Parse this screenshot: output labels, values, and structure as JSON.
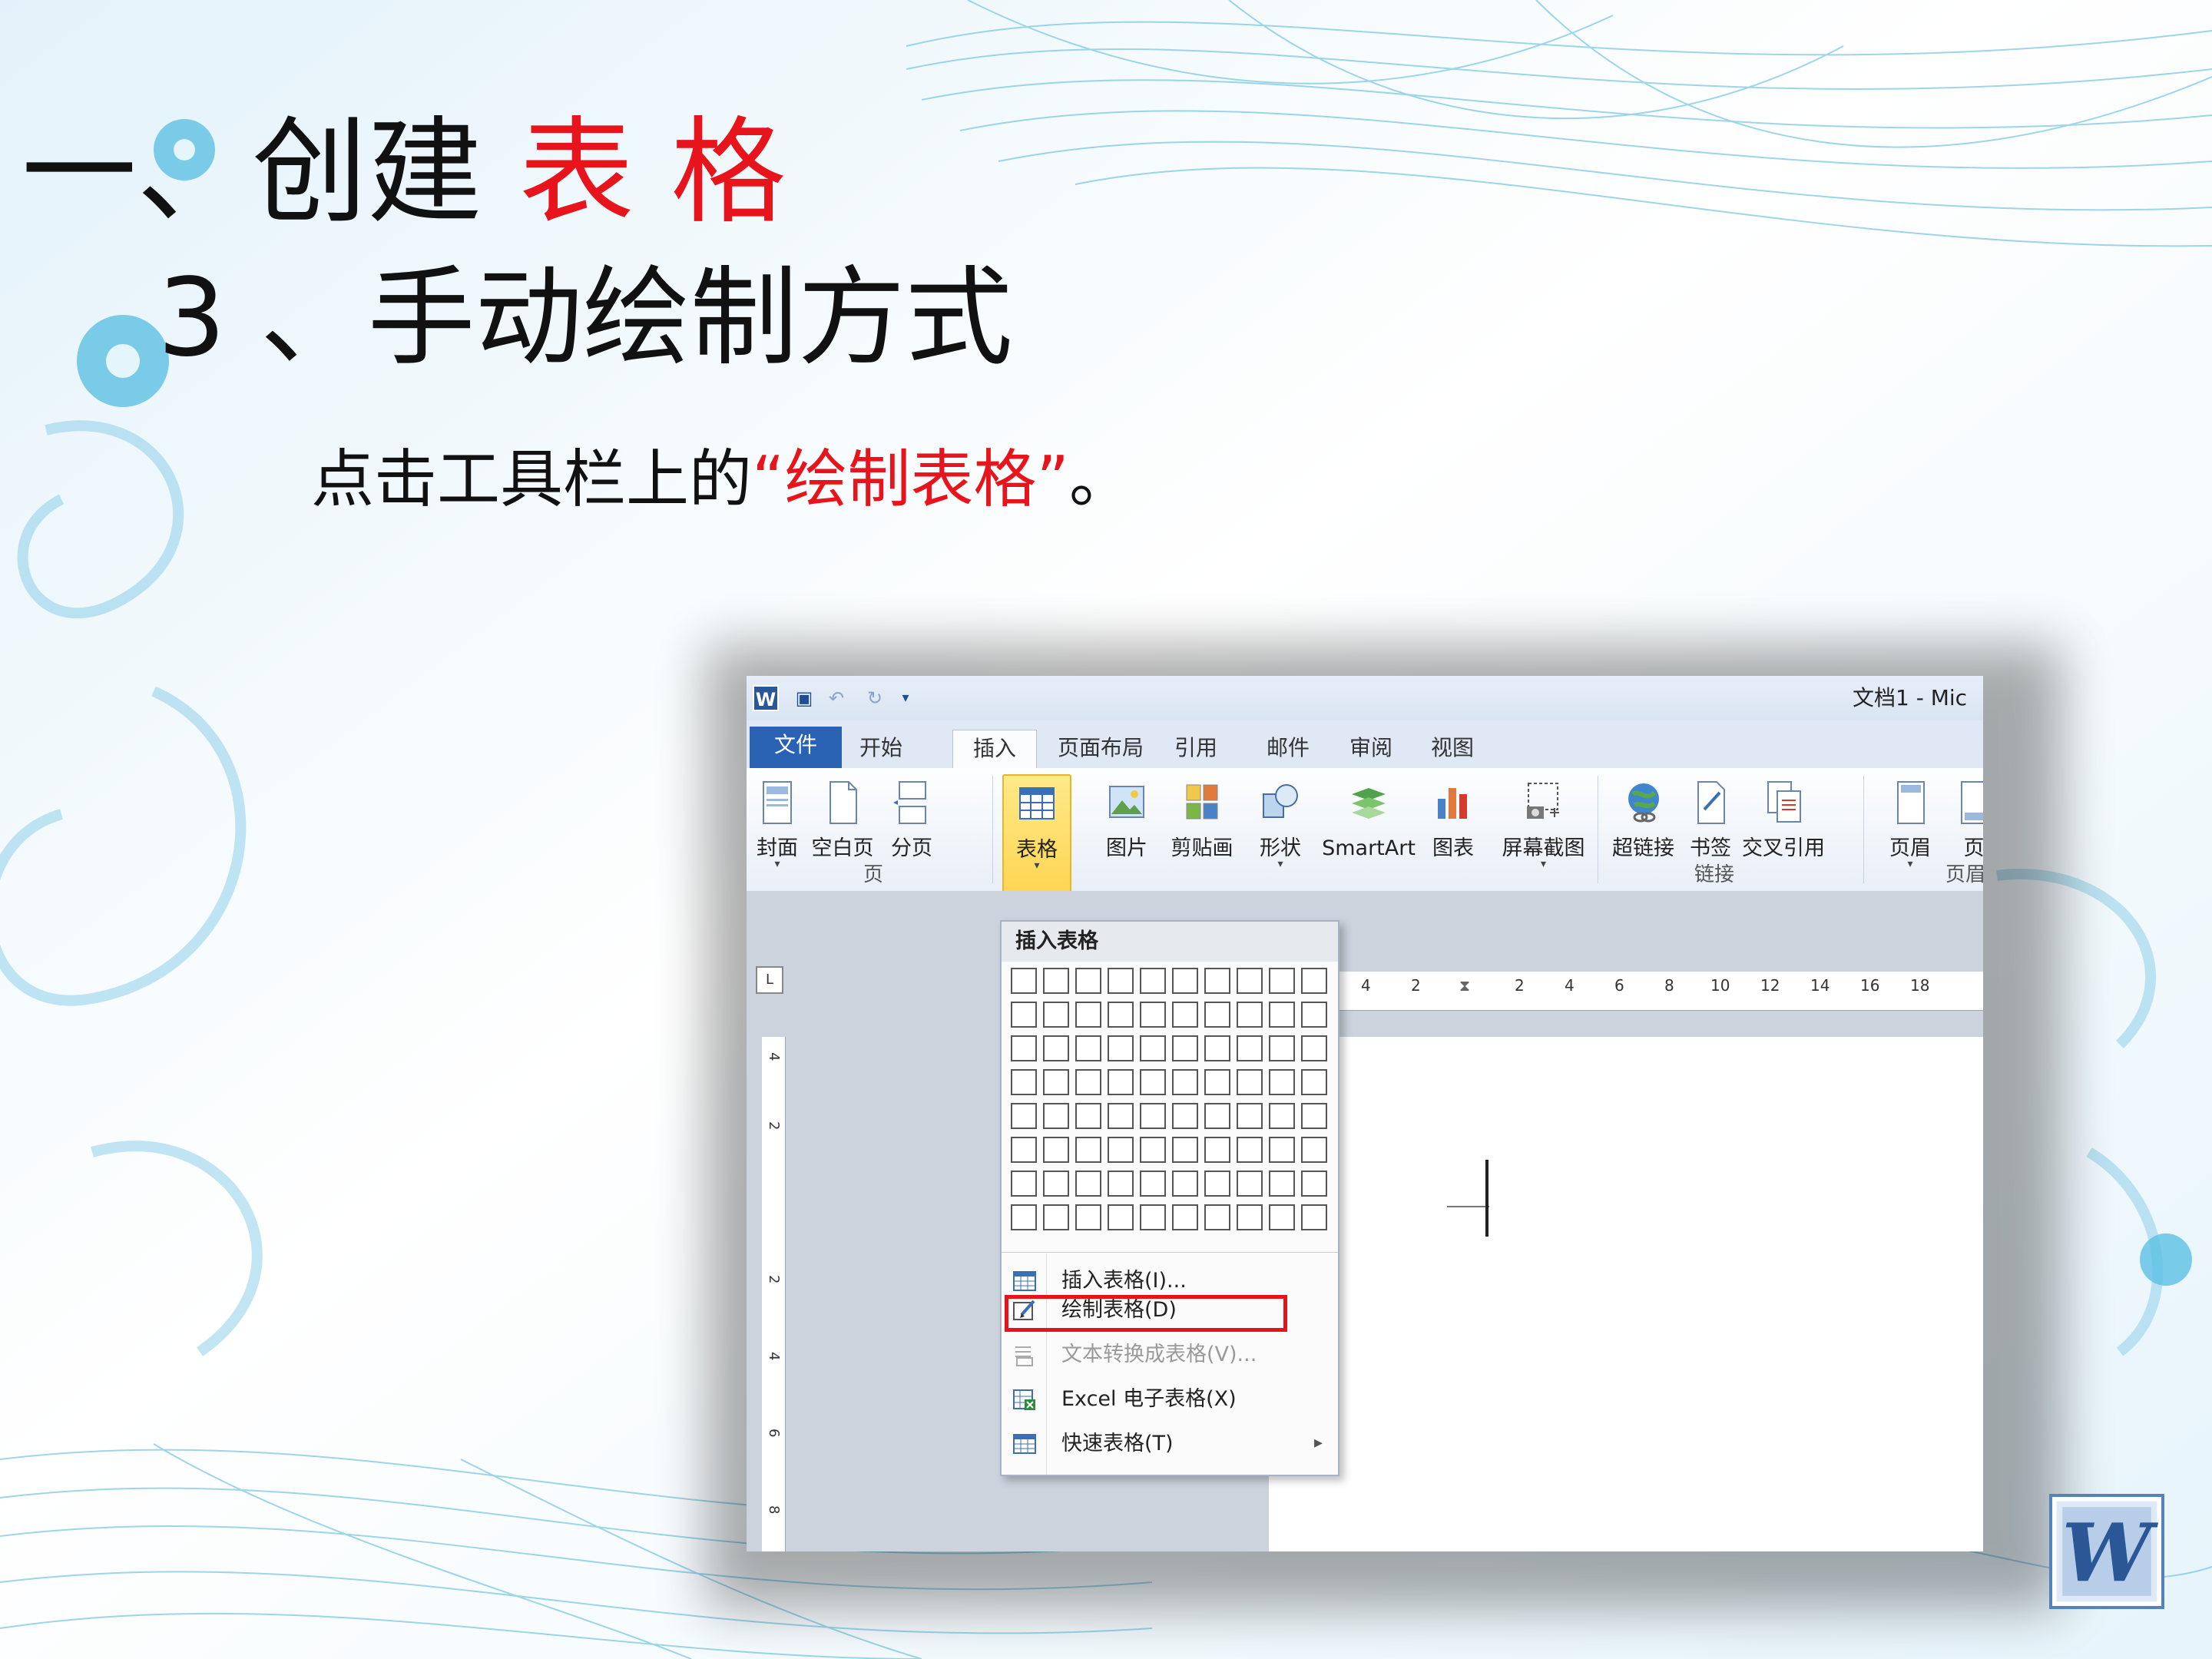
{
  "slide": {
    "title_prefix": "一、创建",
    "title_highlight": "表 格",
    "subtitle": "3 、手动绘制方式",
    "body_before": "点击工具栏上的",
    "body_highlight": "“绘制表格”",
    "body_after": "。"
  },
  "word": {
    "window_title": "文档1 - Mic",
    "tabs": [
      {
        "label": "文件"
      },
      {
        "label": "开始"
      },
      {
        "label": "插入"
      },
      {
        "label": "页面布局"
      },
      {
        "label": "引用"
      },
      {
        "label": "邮件"
      },
      {
        "label": "审阅"
      },
      {
        "label": "视图"
      }
    ],
    "active_tab": "插入",
    "ribbon_buttons": [
      {
        "label": "封面",
        "icon": "cover-page-icon"
      },
      {
        "label": "空白页",
        "icon": "blank-page-icon"
      },
      {
        "label": "分页",
        "icon": "page-break-icon"
      },
      {
        "label": "表格",
        "icon": "table-icon"
      },
      {
        "label": "图片",
        "icon": "picture-icon"
      },
      {
        "label": "剪贴画",
        "icon": "clip-art-icon"
      },
      {
        "label": "形状",
        "icon": "shapes-icon"
      },
      {
        "label": "SmartArt",
        "icon": "smartart-icon"
      },
      {
        "label": "图表",
        "icon": "chart-icon"
      },
      {
        "label": "屏幕截图",
        "icon": "screenshot-icon"
      },
      {
        "label": "超链接",
        "icon": "hyperlink-icon"
      },
      {
        "label": "书签",
        "icon": "bookmark-icon"
      },
      {
        "label": "交叉引用",
        "icon": "cross-reference-icon"
      },
      {
        "label": "页眉",
        "icon": "header-icon"
      },
      {
        "label": "页",
        "icon": "footer-icon"
      }
    ],
    "groups": [
      {
        "label": "页"
      },
      {
        "label": "链接"
      },
      {
        "label": "页眉和"
      }
    ],
    "ruler_h": [
      "4",
      "2",
      "2",
      "4",
      "6",
      "8",
      "10",
      "12",
      "14",
      "16",
      "18"
    ],
    "ruler_v": [
      "4",
      "2",
      "2",
      "4",
      "6",
      "8"
    ],
    "dropdown": {
      "header": "插入表格",
      "grid_columns": 10,
      "grid_rows": 8,
      "items": [
        {
          "label": "插入表格(I)...",
          "icon": "insert-table-icon",
          "enabled": true
        },
        {
          "label": "绘制表格(D)",
          "icon": "draw-table-icon",
          "enabled": true,
          "highlighted": true
        },
        {
          "label": "文本转换成表格(V)...",
          "icon": "convert-text-icon",
          "enabled": false
        },
        {
          "label": "Excel 电子表格(X)",
          "icon": "excel-icon",
          "enabled": true
        },
        {
          "label": "快速表格(T)",
          "icon": "quick-tables-icon",
          "enabled": true,
          "submenu_arrow": "▸"
        }
      ]
    }
  },
  "colors": {
    "accent_red": "#e8141b",
    "word_blue": "#2a62b3",
    "active_button": "#ffd24a"
  },
  "logo": {
    "label": "W"
  }
}
